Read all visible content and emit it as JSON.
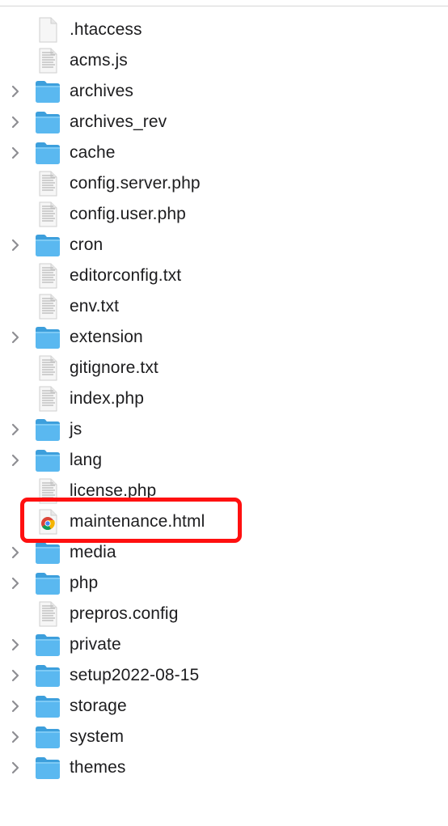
{
  "files": [
    {
      "name": ".htaccess",
      "kind": "file-blank"
    },
    {
      "name": "acms.js",
      "kind": "file-text"
    },
    {
      "name": "archives",
      "kind": "folder"
    },
    {
      "name": "archives_rev",
      "kind": "folder"
    },
    {
      "name": "cache",
      "kind": "folder"
    },
    {
      "name": "config.server.php",
      "kind": "file-text"
    },
    {
      "name": "config.user.php",
      "kind": "file-text"
    },
    {
      "name": "cron",
      "kind": "folder"
    },
    {
      "name": "editorconfig.txt",
      "kind": "file-text"
    },
    {
      "name": "env.txt",
      "kind": "file-text"
    },
    {
      "name": "extension",
      "kind": "folder"
    },
    {
      "name": "gitignore.txt",
      "kind": "file-text"
    },
    {
      "name": "index.php",
      "kind": "file-text"
    },
    {
      "name": "js",
      "kind": "folder"
    },
    {
      "name": "lang",
      "kind": "folder"
    },
    {
      "name": "license.php",
      "kind": "file-text"
    },
    {
      "name": "maintenance.html",
      "kind": "chrome-html",
      "highlighted": true
    },
    {
      "name": "media",
      "kind": "folder"
    },
    {
      "name": "php",
      "kind": "folder"
    },
    {
      "name": "prepros.config",
      "kind": "file-text"
    },
    {
      "name": "private",
      "kind": "folder"
    },
    {
      "name": "setup2022-08-15",
      "kind": "folder"
    },
    {
      "name": "storage",
      "kind": "folder"
    },
    {
      "name": "system",
      "kind": "folder"
    },
    {
      "name": "themes",
      "kind": "folder"
    }
  ],
  "colors": {
    "folder_front": "#5ab8f0",
    "folder_back": "#3d9fdc",
    "highlight_border": "#ff1010",
    "chevron": "#8e8e93"
  },
  "icons": {
    "folder": "folder-icon",
    "file-text": "document-icon",
    "file-blank": "blank-document-icon",
    "chrome-html": "chrome-html-file-icon",
    "chevron": "chevron-right-icon"
  }
}
